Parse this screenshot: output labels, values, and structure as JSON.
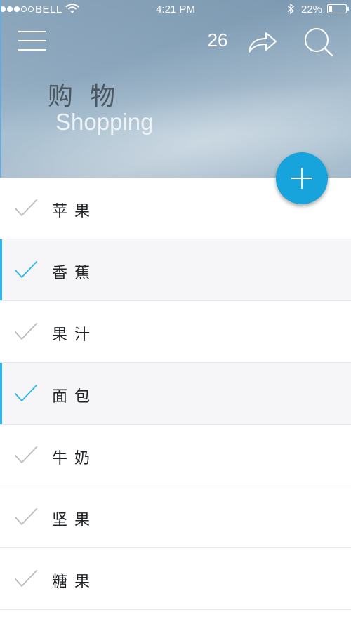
{
  "status_bar": {
    "carrier": "BELL",
    "time": "4:21 PM",
    "battery_percent": "22%",
    "battery_level": 0.22,
    "signal_strength": 3,
    "signal_max": 5
  },
  "toolbar": {
    "count": "26",
    "menu_icon": "hamburger-menu-icon",
    "share_icon": "share-arrow-icon",
    "search_icon": "search-icon"
  },
  "header": {
    "title_cn": "购物",
    "title_en": "Shopping"
  },
  "fab": {
    "icon": "plus-icon",
    "color": "#17a4dc"
  },
  "colors": {
    "accent": "#2bb5ee",
    "unchecked": "#b9bcc0"
  },
  "list": {
    "items": [
      {
        "label": "苹果",
        "checked": false
      },
      {
        "label": "香蕉",
        "checked": true
      },
      {
        "label": "果汁",
        "checked": false
      },
      {
        "label": "面包",
        "checked": true
      },
      {
        "label": "牛奶",
        "checked": false
      },
      {
        "label": "坚果",
        "checked": false
      },
      {
        "label": "糖果",
        "checked": false
      }
    ]
  }
}
